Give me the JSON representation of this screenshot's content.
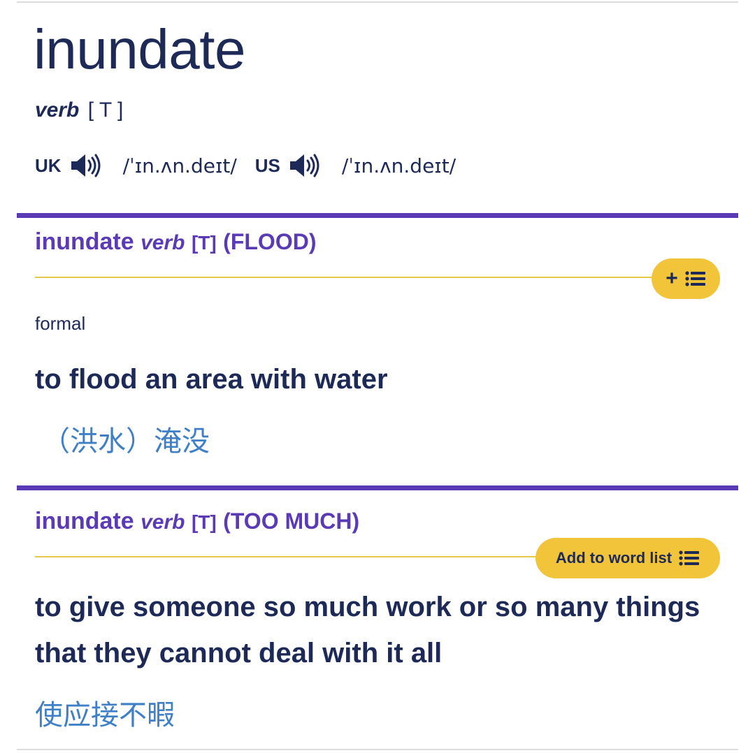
{
  "entry": {
    "headword": "inundate",
    "pos": "verb",
    "grammar": "[ T ]",
    "pronunciations": [
      {
        "region": "UK",
        "ipa": "/ˈɪn.ʌn.deɪt/",
        "icon": "speaker-icon"
      },
      {
        "region": "US",
        "ipa": "/ˈɪn.ʌn.deɪt/",
        "icon": "speaker-icon"
      }
    ]
  },
  "senses": [
    {
      "headword": "inundate",
      "pos": "verb",
      "grammar": "[T]",
      "guideword": "(FLOOD)",
      "word_list_button": {
        "label": "+",
        "icon": "list-icon"
      },
      "register": "formal",
      "definition": "to flood an area with water",
      "translation": "（洪水）淹没"
    },
    {
      "headword": "inundate",
      "pos": "verb",
      "grammar": "[T]",
      "guideword": "(TOO MUCH)",
      "word_list_button": {
        "label": "Add to word list",
        "icon": "list-icon"
      },
      "definition": "to give someone so much work or so many things that they cannot deal with it all",
      "translation": "使应接不暇"
    }
  ],
  "colors": {
    "text": "#1d2a57",
    "accent_purple": "#5a3bb5",
    "button_yellow": "#f2c43a",
    "gold_rule": "#e6c84a",
    "translation_blue": "#3f7fc6"
  }
}
